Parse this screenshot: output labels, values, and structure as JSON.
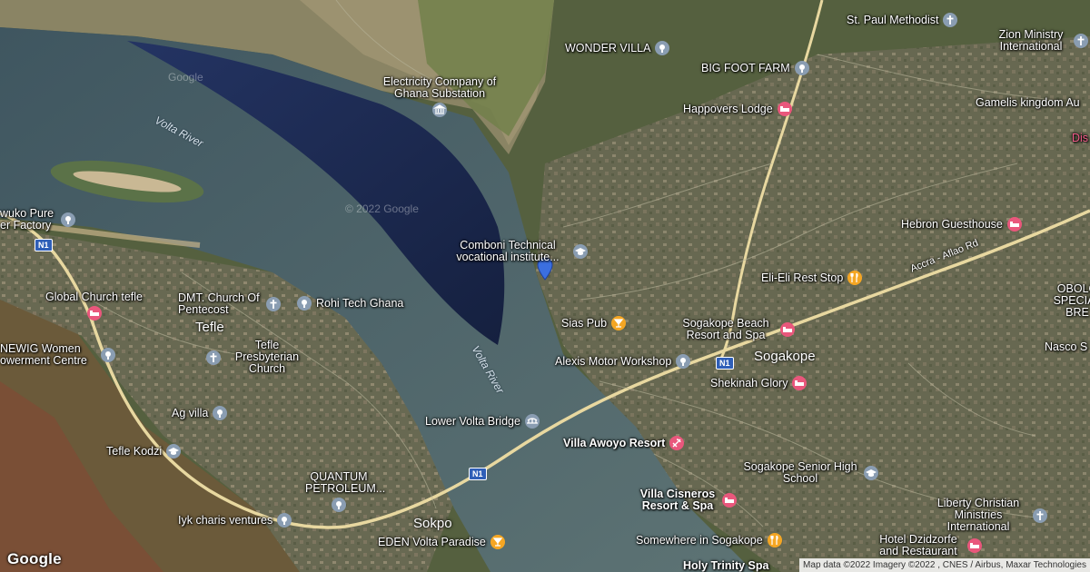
{
  "map": {
    "watermarks": [
      "Google",
      "© 2022 Google"
    ],
    "logo": "Google",
    "attribution": "Map data ©2022 Imagery ©2022 , CNES / Airbus, Maxar Technologies",
    "rivers": [
      "Volta River",
      "Volta River"
    ],
    "towns": [
      "Tefle",
      "Sogakope",
      "Sokpo"
    ],
    "road_label": "Accra - Aflao Rd",
    "road_shields": [
      "N1",
      "N1",
      "N1"
    ],
    "colors": {
      "water": "#1c2a52",
      "road": "#e8d8a0",
      "food": "#f5a623",
      "lodging": "#e9577c",
      "generic": "#8a9db2"
    }
  },
  "pois": [
    {
      "label": "St. Paul Methodist",
      "icon": "church-icon"
    },
    {
      "label": "Zion Ministry International",
      "icon": "church-icon"
    },
    {
      "label": "WONDER VILLA",
      "icon": "place-icon"
    },
    {
      "label": "BIG FOOT FARM",
      "icon": "place-icon"
    },
    {
      "label": "Electricity Company of Ghana Substation",
      "icon": "building-icon"
    },
    {
      "label": "Happovers Lodge",
      "icon": "hotel-icon"
    },
    {
      "label": "Gamelis kingdom Au",
      "icon": "none"
    },
    {
      "label": "Dis",
      "icon": "none"
    },
    {
      "label": "wuko Pure er Factory",
      "icon": "place-icon"
    },
    {
      "label": "Hebron Guesthouse",
      "icon": "hotel-icon"
    },
    {
      "label": "Comboni Technical vocational institute...",
      "icon": "school-icon"
    },
    {
      "label": "Eli-Eli Rest Stop",
      "icon": "restaurant-icon"
    },
    {
      "label": "OBOLO SPECIAL BRE",
      "icon": "none"
    },
    {
      "label": "Global Church tefle",
      "icon": "hotel-icon"
    },
    {
      "label": "DMT. Church Of Pentecost",
      "icon": "church-icon"
    },
    {
      "label": "Rohi Tech Ghana",
      "icon": "place-icon"
    },
    {
      "label": "Sias Pub",
      "icon": "bar-icon"
    },
    {
      "label": "Sogakope Beach Resort and Spa",
      "icon": "hotel-icon"
    },
    {
      "label": "Nasco S",
      "icon": "none"
    },
    {
      "label": "NEWIG Women owerment Centre",
      "icon": "place-icon"
    },
    {
      "label": "Tefle Presbyterian Church",
      "icon": "church-icon"
    },
    {
      "label": "Alexis Motor Workshop",
      "icon": "place-icon"
    },
    {
      "label": "Shekinah Glory",
      "icon": "hotel-icon"
    },
    {
      "label": "Ag villa",
      "icon": "place-icon"
    },
    {
      "label": "Lower Volta Bridge",
      "icon": "bridge-icon"
    },
    {
      "label": "Villa Awoyo Resort",
      "icon": "resort-icon"
    },
    {
      "label": "Tefle Kodzi",
      "icon": "school-icon"
    },
    {
      "label": "Sogakope Senior High School",
      "icon": "school-icon"
    },
    {
      "label": "QUANTUM PETROLEUM...",
      "icon": "place-icon"
    },
    {
      "label": "Villa Cisneros Resort & Spa",
      "icon": "hotel-icon"
    },
    {
      "label": "Liberty Christian Ministries International",
      "icon": "church-icon"
    },
    {
      "label": "Iyk charis ventures",
      "icon": "place-icon"
    },
    {
      "label": "EDEN Volta Paradise",
      "icon": "bar-icon"
    },
    {
      "label": "Somewhere in Sogakope",
      "icon": "restaurant-icon"
    },
    {
      "label": "Hotel Dzidzorfe and Restaurant",
      "icon": "hotel-icon"
    },
    {
      "label": "Holy Trinity Spa",
      "icon": "none"
    }
  ]
}
